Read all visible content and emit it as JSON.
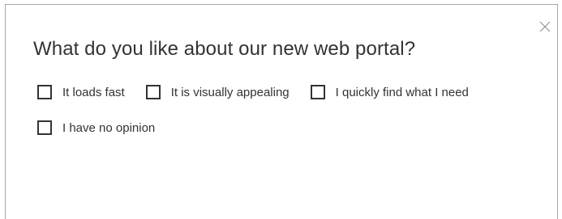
{
  "dialog": {
    "question": "What do you like about our new web portal?",
    "close_icon": "close-icon"
  },
  "options": [
    {
      "label": "It loads fast",
      "checked": false
    },
    {
      "label": "It is visually appealing",
      "checked": false
    },
    {
      "label": "I quickly find what I need",
      "checked": false
    },
    {
      "label": "I have no opinion",
      "checked": false
    }
  ],
  "colors": {
    "text": "#333333",
    "border": "#a6a6a6",
    "close_icon": "#8a8a8a",
    "background": "#ffffff"
  }
}
